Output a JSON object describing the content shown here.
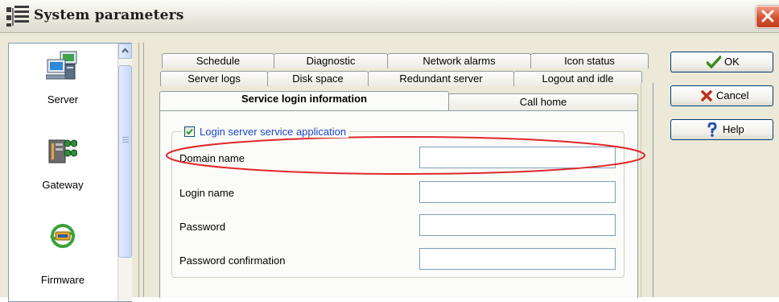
{
  "window": {
    "title": "System parameters"
  },
  "sidebar": {
    "items": [
      {
        "label": "Server",
        "icon": "server-icon"
      },
      {
        "label": "Gateway",
        "icon": "gateway-icon"
      },
      {
        "label": "Firmware",
        "icon": "firmware-icon"
      }
    ]
  },
  "tabs": {
    "row1": [
      "Schedule",
      "Diagnostic",
      "Network alarms",
      "Icon status"
    ],
    "row2": [
      "Server logs",
      "Disk space",
      "Redundant server",
      "Logout and idle"
    ],
    "row3": [
      "Service login information",
      "Call home"
    ],
    "active": "Service login information"
  },
  "form": {
    "group_title": "Login server service application",
    "group_checked": true,
    "fields": [
      {
        "label": "Domain name",
        "value": ""
      },
      {
        "label": "Login name",
        "value": ""
      },
      {
        "label": "Password",
        "value": ""
      },
      {
        "label": "Password confirmation",
        "value": ""
      }
    ]
  },
  "buttons": {
    "ok": "OK",
    "cancel": "Cancel",
    "help": "Help"
  },
  "colors": {
    "annotation": "#e0282a",
    "group_title": "#1b46c9",
    "ok_check": "#3a8a1e",
    "cancel_x": "#c0311c",
    "help_q": "#2a4fb5"
  }
}
